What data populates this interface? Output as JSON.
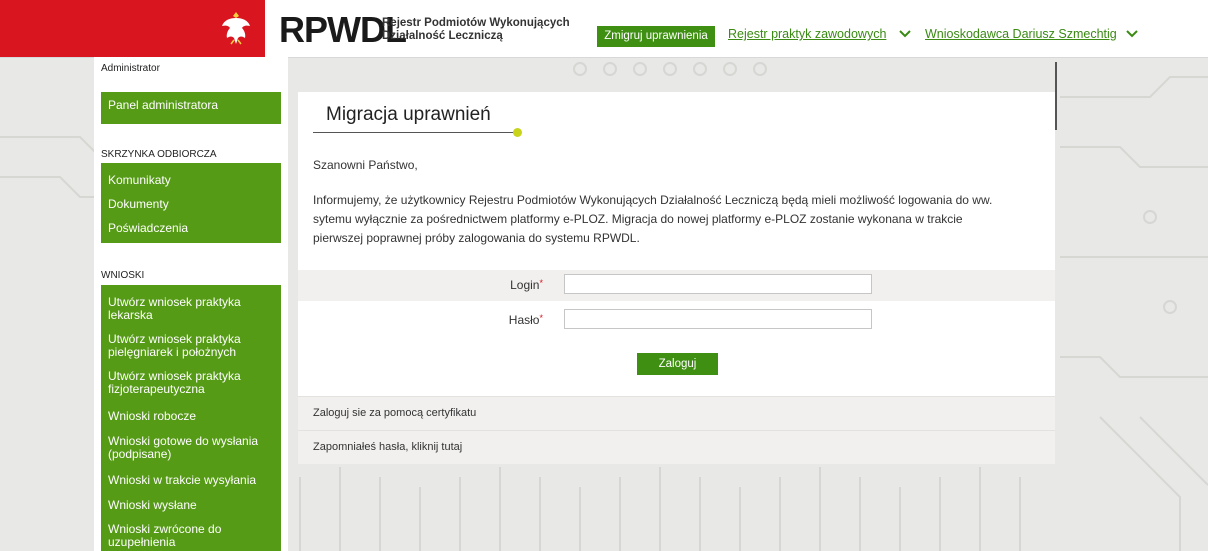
{
  "header": {
    "logo": "RPWDL",
    "subtitle_line1": "Rejestr Podmiotów Wykonujących",
    "subtitle_line2": "Działalność Leczniczą",
    "migrate_button": "Zmigruj uprawnienia",
    "registry_link": "Rejestr praktyk zawodowych",
    "user_link": "Wnioskodawca Dariusz Szmechtig",
    "colors": {
      "brand_red": "#d9151f",
      "green": "#3f8f13",
      "accent": "#c7d41a"
    },
    "icons": [
      "poland-eagle-icon",
      "chevron-down-icon",
      "chevron-down-icon"
    ]
  },
  "sidebar": {
    "admin_section": "Administrator",
    "admin_items": [
      "Panel administratora"
    ],
    "inbox_section": "SKRZYNKA ODBIORCZA",
    "inbox_items": [
      "Komunikaty",
      "Dokumenty",
      "Poświadczenia"
    ],
    "requests_section": "WNIOSKI",
    "requests_items": [
      "Utwórz wniosek praktyka lekarska",
      "Utwórz wniosek praktyka pielęgniarek i położnych",
      "Utwórz wniosek praktyka fizjoterapeutyczna",
      "Wnioski robocze",
      "Wnioski gotowe do wysłania (podpisane)",
      "Wnioski w trakcie wysyłania",
      "Wnioski wysłane",
      "Wnioski zwrócone do uzupełnienia"
    ]
  },
  "main": {
    "title": "Migracja uprawnień",
    "greeting": "Szanowni Państwo,",
    "info_line1": "Informujemy, że użytkownicy Rejestru Podmiotów Wykonujących Działalność Leczniczą będą mieli możliwość logowania do ww.",
    "info_line2": "sytemu wyłącznie za pośrednictwem platformy e-PLOZ. Migracja do nowej platformy e-PLOZ zostanie wykonana w trakcie",
    "info_line3": "pierwszej poprawnej próby zalogowania do systemu RPWDL.",
    "form": {
      "login_label": "Login",
      "login_value": "",
      "password_label": "Hasło",
      "password_value": "",
      "required_mark": "*",
      "submit": "Zaloguj"
    },
    "cert_link": "Zaloguj sie za pomocą certyfikatu",
    "forgot_link": "Zapomniałeś hasła, kliknij tutaj"
  }
}
